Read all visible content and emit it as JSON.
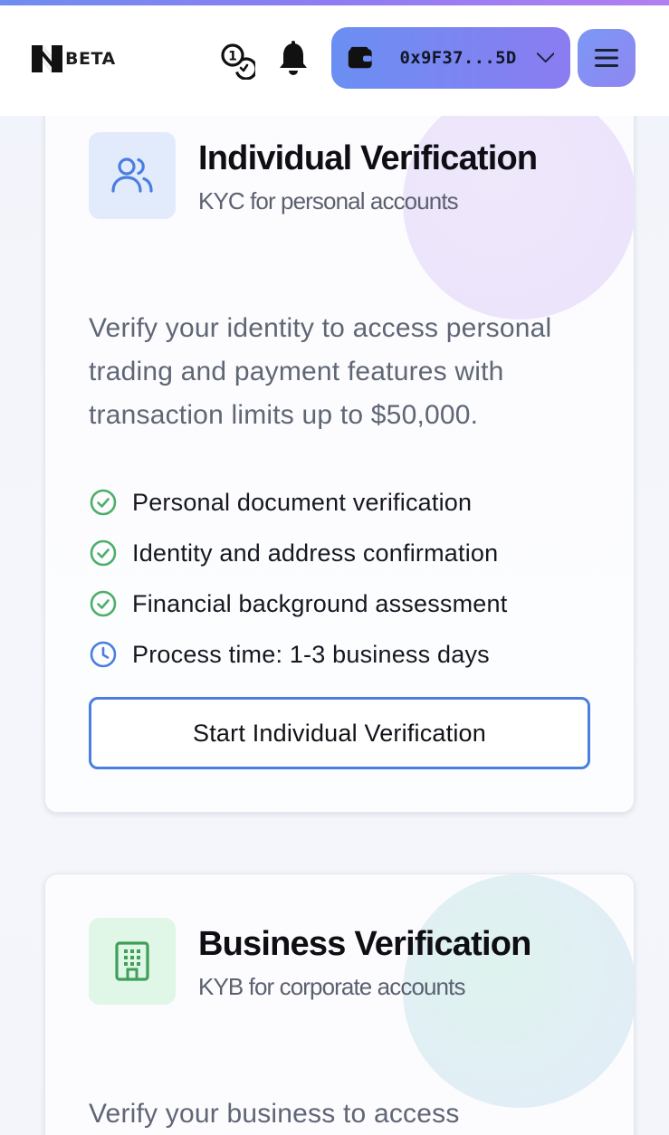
{
  "header": {
    "logo_text": "BETA",
    "wallet_address": "0x9F37...5D",
    "icons": {
      "logo": "n-logo-icon",
      "swap": "swap-coins-icon",
      "notifications": "bell-icon",
      "wallet": "wallet-icon",
      "wallet_dropdown": "chevron-down-icon",
      "menu": "hamburger-menu-icon"
    }
  },
  "cards": [
    {
      "title": "Individual Verification",
      "subtitle": "KYC for personal accounts",
      "icon": "users-icon",
      "description": "Verify your identity to access personal trading and payment features with transaction limits up to $50,000.",
      "features": [
        {
          "text": "Personal document verification",
          "icon": "check-circle-icon"
        },
        {
          "text": "Identity and address confirmation",
          "icon": "check-circle-icon"
        },
        {
          "text": "Financial background assessment",
          "icon": "check-circle-icon"
        },
        {
          "text": "Process time: 1-3 business days",
          "icon": "clock-icon"
        }
      ],
      "button_label": "Start Individual Verification"
    },
    {
      "title": "Business Verification",
      "subtitle": "KYB for corporate accounts",
      "icon": "building-icon",
      "description": "Verify your business to access"
    }
  ],
  "colors": {
    "accent_blue": "#4a7ee0",
    "check_green": "#4caf6a",
    "clock_blue": "#4a7ee0",
    "wallet_gradient_start": "#6a8ff3",
    "wallet_gradient_end": "#8b7cf1"
  }
}
